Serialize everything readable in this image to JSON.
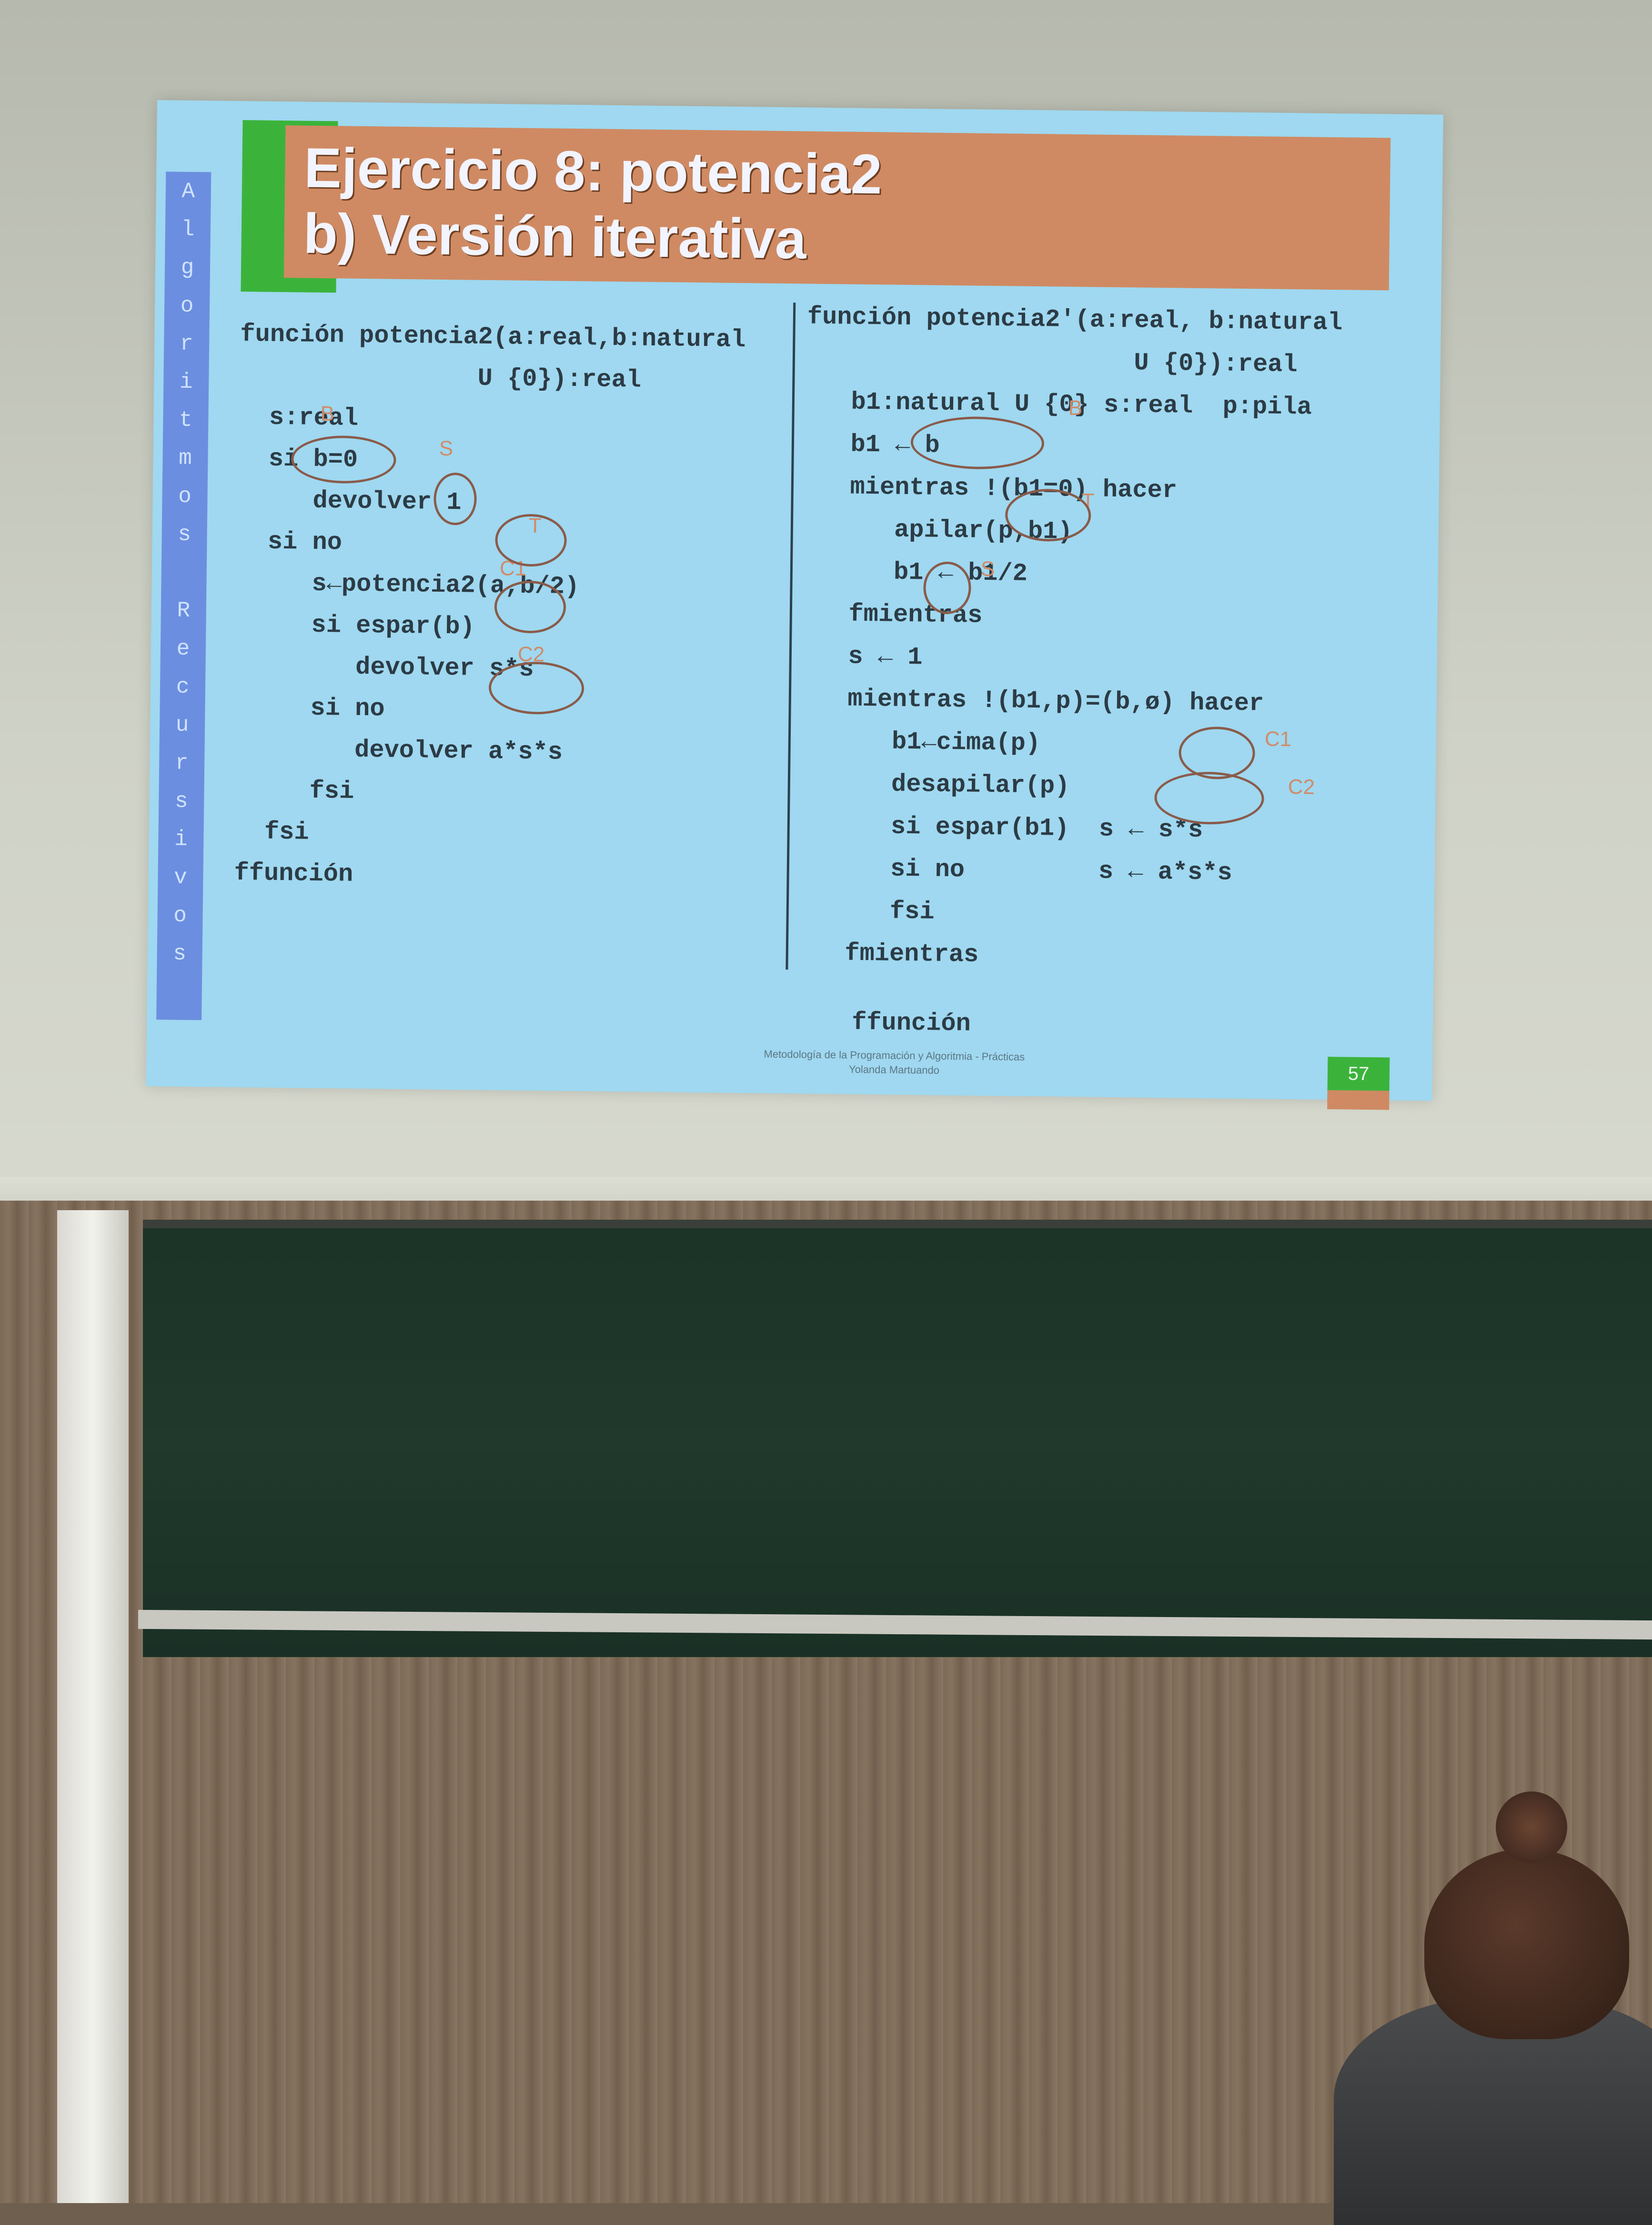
{
  "slide": {
    "side_letters": [
      "A",
      "l",
      "g",
      "o",
      "r",
      "i",
      "t",
      "m",
      "o",
      "s",
      "",
      "R",
      "e",
      "c",
      "u",
      "r",
      "s",
      "i",
      "v",
      "o",
      "s"
    ],
    "title_line1": "Ejercicio 8: potencia2",
    "title_line2": "b) Versión iterativa",
    "left_code": [
      "función potencia2(a:real,b:natural",
      "                U {0}):real",
      "  s:real",
      "  si b=0",
      "     devolver 1",
      "  si no",
      "     s←potencia2(a,b/2)",
      "     si espar(b)",
      "        devolver s*s",
      "     si no",
      "        devolver a*s*s",
      "     fsi",
      "  fsi",
      "ffunción"
    ],
    "right_code": [
      "función potencia2'(a:real, b:natural",
      "                      U {0}):real",
      "   b1:natural U {0} s:real  p:pila",
      "   b1 ← b",
      "   mientras !(b1=0) hacer",
      "      apilar(p,b1)",
      "      b1 ← b1/2",
      "   fmientras",
      "   s ← 1",
      "   mientras !(b1,p)=(b,ø) hacer",
      "      b1←cima(p)",
      "      desapilar(p)",
      "      si espar(b1)  s ← s*s",
      "      si no         s ← a*s*s",
      "      fsi",
      "   fmientras"
    ],
    "end_label": "ffunción",
    "annotations_left": {
      "b": "B",
      "s": "S",
      "t": "T",
      "c1": "C1",
      "c2": "C2"
    },
    "annotations_right": {
      "b": "B",
      "t": "T",
      "s": "S",
      "c1": "C1",
      "c2": "C2"
    },
    "footer_line1": "Metodología de la Programación y Algoritmia - Prácticas",
    "footer_line2": "Yolanda Martuando",
    "page_number": "57"
  }
}
